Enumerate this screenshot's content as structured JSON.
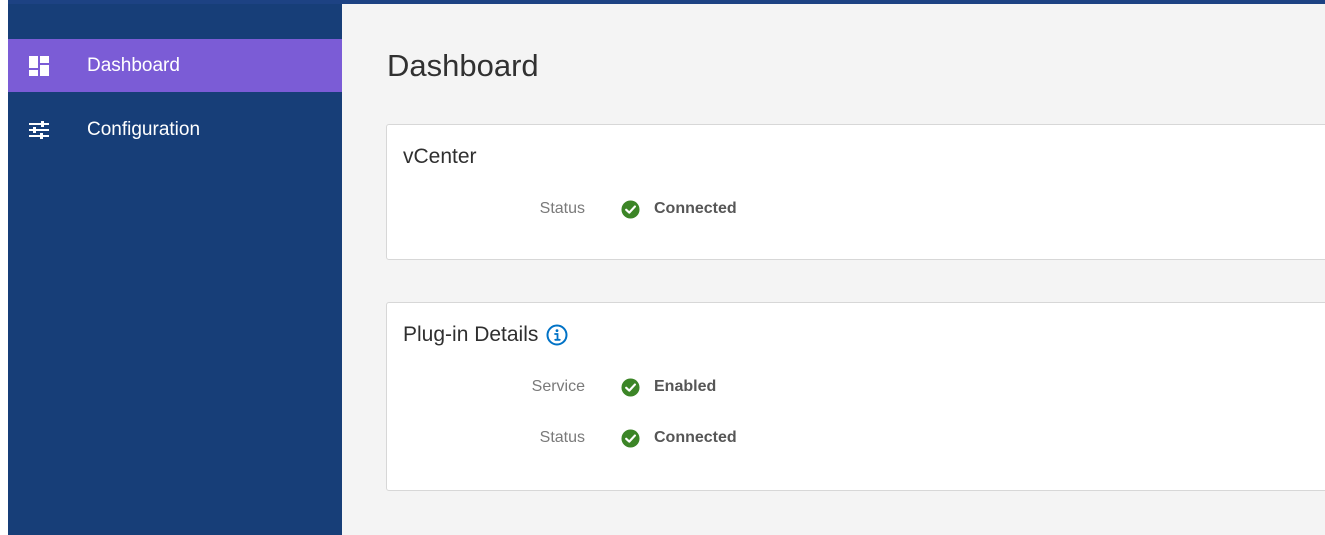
{
  "sidebar": {
    "items": [
      {
        "label": "Dashboard",
        "icon": "dashboard-icon",
        "active": true
      },
      {
        "label": "Configuration",
        "icon": "sliders-icon",
        "active": false
      }
    ]
  },
  "main": {
    "title": "Dashboard",
    "vcenter_card": {
      "title": "vCenter",
      "rows": [
        {
          "label": "Status",
          "value": "Connected",
          "icon": "check-circle-icon"
        }
      ]
    },
    "plugin_card": {
      "title": "Plug-in Details",
      "info_icon": "info-icon",
      "rows": [
        {
          "label": "Service",
          "value": "Enabled",
          "icon": "check-circle-icon"
        },
        {
          "label": "Status",
          "value": "Connected",
          "icon": "check-circle-icon"
        }
      ]
    }
  },
  "colors": {
    "sidebar_bg": "#173e78",
    "active_item": "#7b5cd6",
    "success_green": "#3c8527",
    "info_blue": "#0072c6"
  }
}
